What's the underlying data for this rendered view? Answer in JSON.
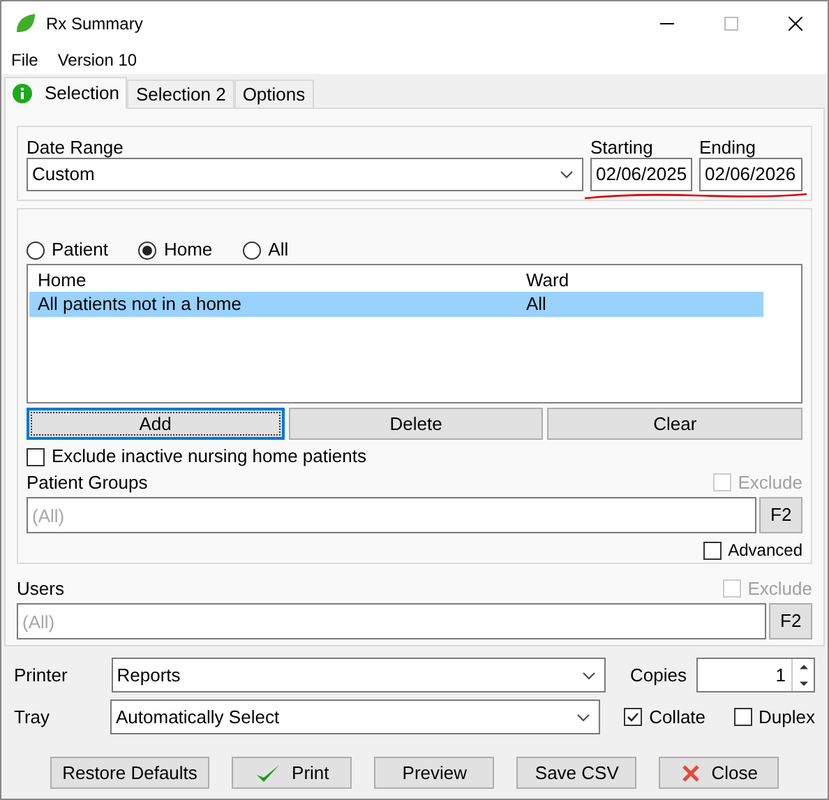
{
  "window": {
    "title": "Rx Summary"
  },
  "menu": [
    "File",
    "Version 10"
  ],
  "tabs": [
    {
      "label": "Selection",
      "selected": true,
      "flagged": true
    },
    {
      "label": "Selection 2",
      "selected": false,
      "flagged": false
    },
    {
      "label": "Options",
      "selected": false,
      "flagged": false
    }
  ],
  "date_range": {
    "label": "Date Range",
    "value": "Custom"
  },
  "starting": {
    "label": "Starting",
    "value": "02/06/2025"
  },
  "ending": {
    "label": "Ending",
    "value": "02/06/2026"
  },
  "scope_radios": [
    {
      "label": "Patient",
      "selected": false
    },
    {
      "label": "Home",
      "selected": true
    },
    {
      "label": "All",
      "selected": false
    }
  ],
  "homes_list": {
    "columns": [
      "Home",
      "Ward"
    ],
    "rows": [
      {
        "cells": [
          "All patients not in a home",
          "All"
        ],
        "selected": true
      }
    ]
  },
  "list_buttons": [
    {
      "label": "Add",
      "focused": true
    },
    {
      "label": "Delete",
      "focused": false
    },
    {
      "label": "Clear",
      "focused": false
    }
  ],
  "exclude_inactive": {
    "label": "Exclude inactive nursing home patients",
    "checked": false
  },
  "patient_groups": {
    "label": "Patient Groups",
    "placeholder": "(All)",
    "button": "F2",
    "exclude": {
      "label": "Exclude",
      "checked": false,
      "disabled": true
    }
  },
  "advanced": {
    "label": "Advanced",
    "checked": false
  },
  "users": {
    "label": "Users",
    "placeholder": "(All)",
    "button": "F2",
    "exclude": {
      "label": "Exclude",
      "checked": false,
      "disabled": true
    }
  },
  "printer": {
    "label": "Printer",
    "value": "Reports"
  },
  "tray": {
    "label": "Tray",
    "value": "Automatically Select"
  },
  "copies": {
    "label": "Copies",
    "value": "1"
  },
  "collate": {
    "label": "Collate",
    "checked": true
  },
  "duplex": {
    "label": "Duplex",
    "checked": false
  },
  "actions": [
    {
      "label": "Restore Defaults",
      "kind": "plain"
    },
    {
      "label": "Print",
      "kind": "print"
    },
    {
      "label": "Preview",
      "kind": "plain"
    },
    {
      "label": "Save CSV",
      "kind": "plain"
    },
    {
      "label": "Close",
      "kind": "close"
    }
  ]
}
